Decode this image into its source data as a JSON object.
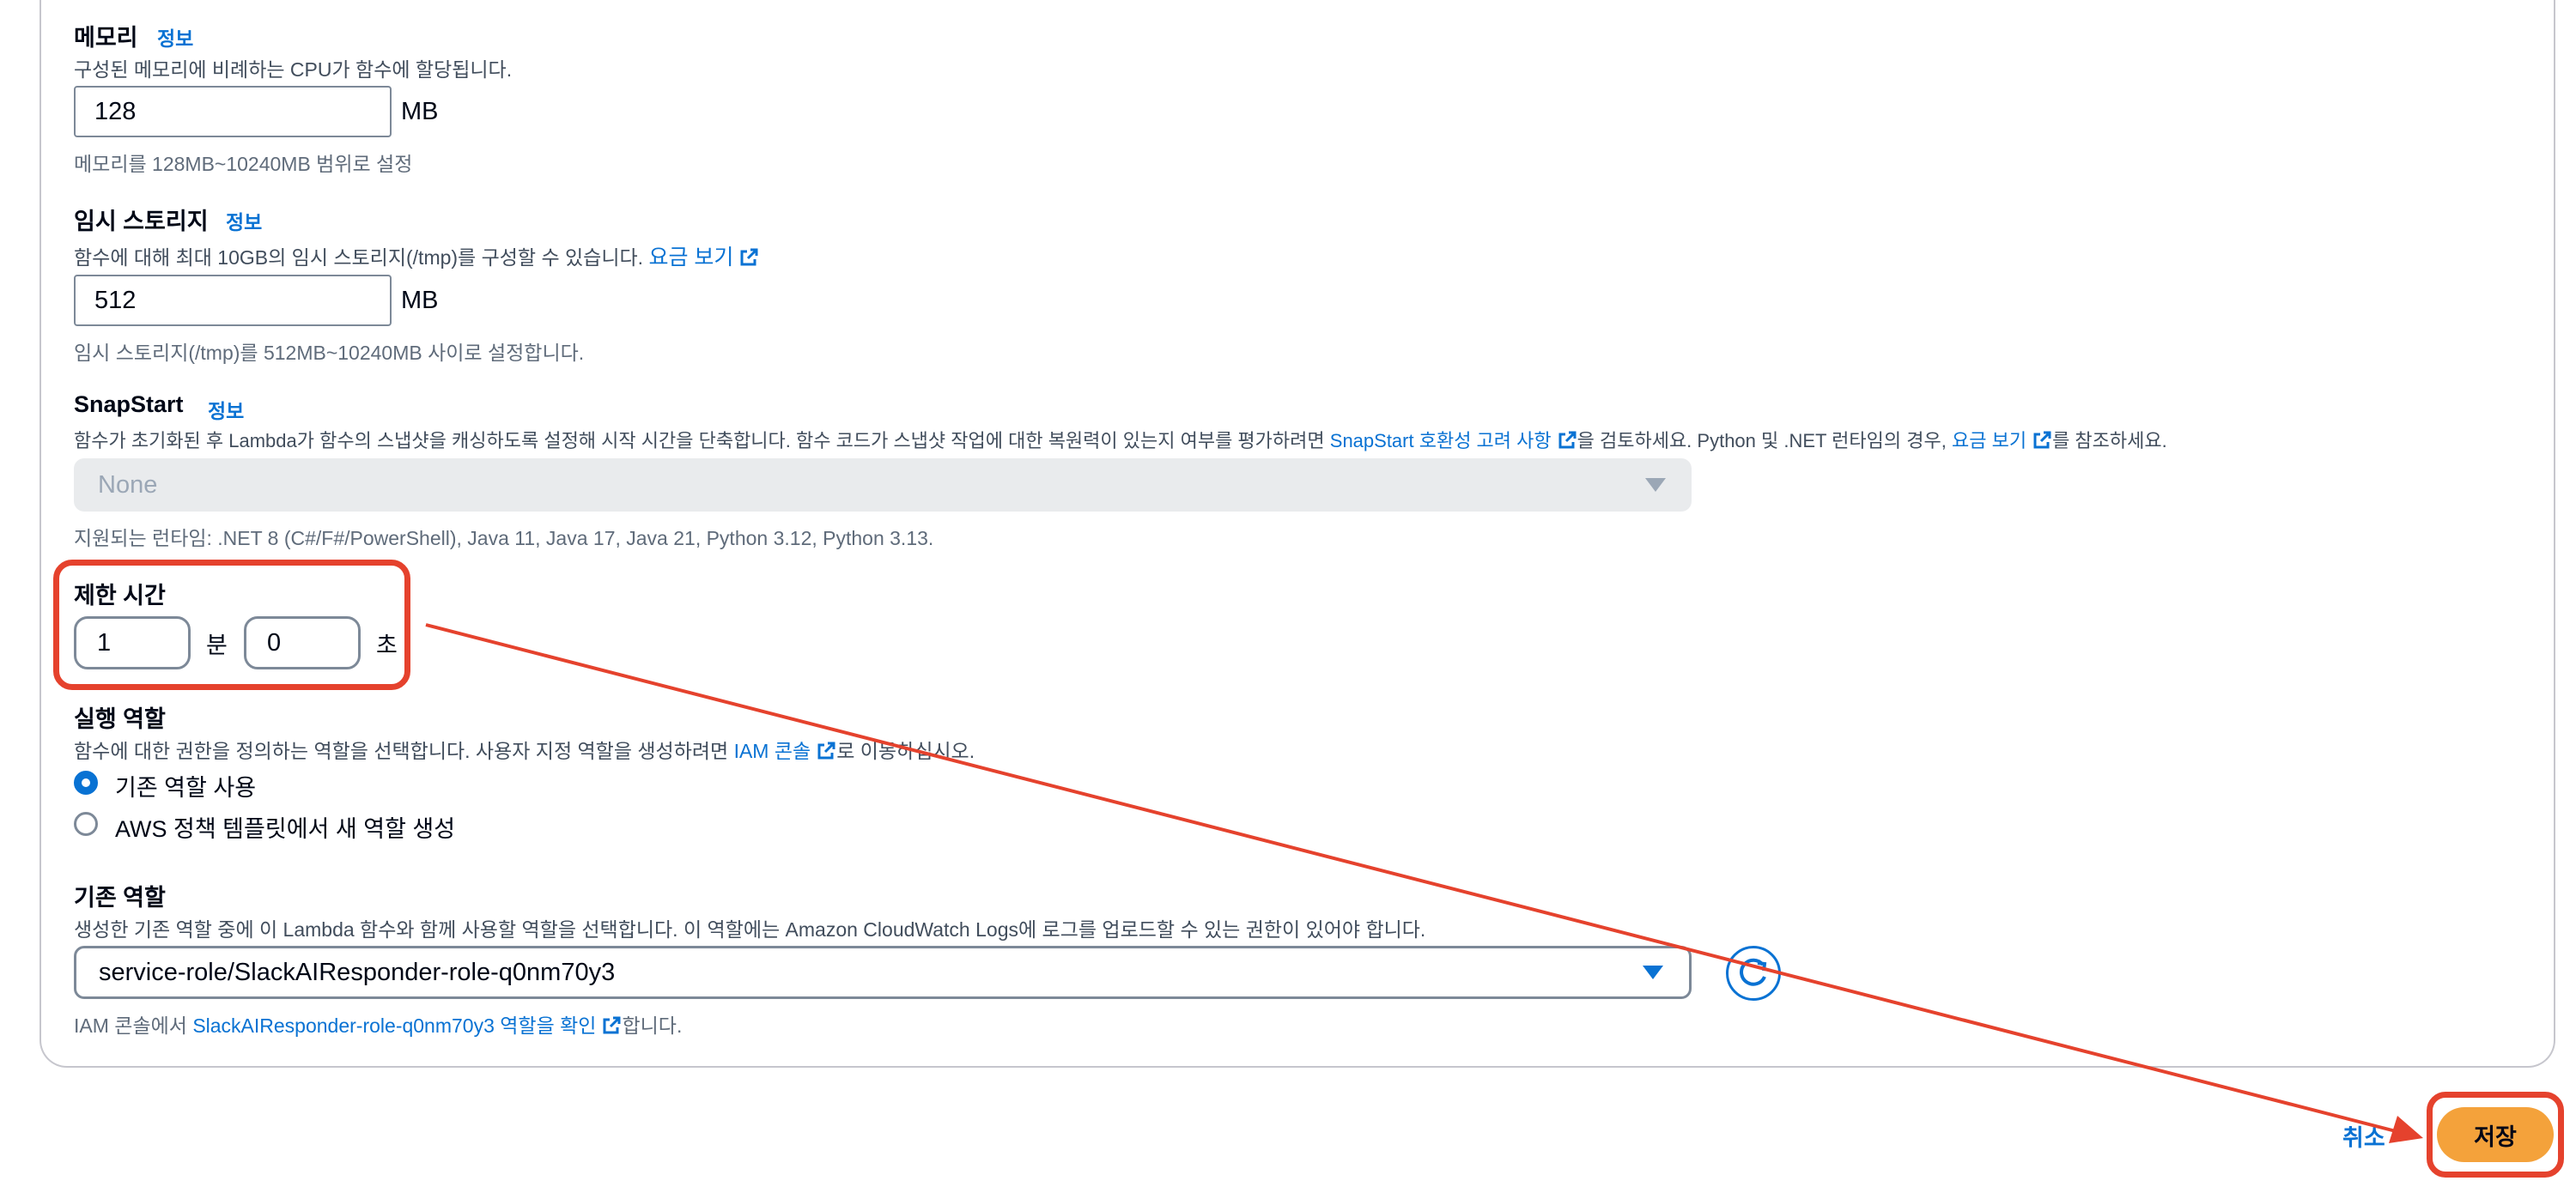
{
  "memory": {
    "label": "메모리",
    "info": "정보",
    "description": "구성된 메모리에 비례하는 CPU가 함수에 할당됩니다.",
    "value": "128",
    "unit": "MB",
    "hint": "메모리를 128MB~10240MB 범위로 설정"
  },
  "ephemeral_storage": {
    "label": "임시 스토리지",
    "info": "정보",
    "description": "함수에 대해 최대 10GB의 임시 스토리지(/tmp)를 구성할 수 있습니다.",
    "pricing_link": "요금 보기",
    "value": "512",
    "unit": "MB",
    "hint": "임시 스토리지(/tmp)를 512MB~10240MB 사이로 설정합니다."
  },
  "snapstart": {
    "label": "SnapStart",
    "info": "정보",
    "description_1": "함수가 초기화된 후 Lambda가 함수의 스냅샷을 캐싱하도록 설정해 시작 시간을 단축합니다. 함수 코드가 스냅샷 작업에 대한 복원력이 있는지 여부를 평가하려면",
    "compat_link": "SnapStart 호환성 고려 사항",
    "description_2": "을 검토하세요. Python 및 .NET 런타임의 경우,",
    "pricing_link": "요금 보기",
    "description_3": "를 참조하세요.",
    "selected": "None",
    "supported_runtimes": "지원되는 런타임: .NET 8 (C#/F#/PowerShell), Java 11, Java 17, Java 21, Python 3.12, Python 3.13."
  },
  "timeout": {
    "label": "제한 시간",
    "minutes_value": "1",
    "minutes_unit": "분",
    "seconds_value": "0",
    "seconds_unit": "초"
  },
  "execution_role": {
    "label": "실행 역할",
    "description": "함수에 대한 권한을 정의하는 역할을 선택합니다. 사용자 지정 역할을 생성하려면",
    "iam_link": "IAM 콘솔",
    "description_end": "로 이동하십시오.",
    "options": [
      {
        "label": "기존 역할 사용",
        "selected": true
      },
      {
        "label": "AWS 정책 템플릿에서 새 역할 생성",
        "selected": false
      }
    ]
  },
  "existing_role": {
    "label": "기존 역할",
    "description": "생성한 기존 역할 중에 이 Lambda 함수와 함께 사용할 역할을 선택합니다. 이 역할에는 Amazon CloudWatch Logs에 로그를 업로드할 수 있는 권한이 있어야 합니다.",
    "selected": "service-role/SlackAIResponder-role-q0nm70y3",
    "hint_prefix": "IAM 콘솔에서",
    "hint_link": "SlackAIResponder-role-q0nm70y3 역할을 확인",
    "hint_suffix": "합니다."
  },
  "footer": {
    "cancel_label": "취소",
    "save_label": "저장"
  },
  "colors": {
    "accent": "#0972d3",
    "save_button": "#f4a23b",
    "annotation": "#e5422d"
  }
}
